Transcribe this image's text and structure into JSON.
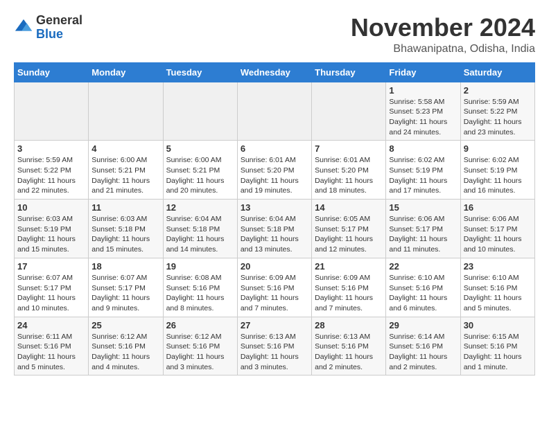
{
  "logo": {
    "general": "General",
    "blue": "Blue"
  },
  "title": "November 2024",
  "location": "Bhawanipatna, Odisha, India",
  "days_of_week": [
    "Sunday",
    "Monday",
    "Tuesday",
    "Wednesday",
    "Thursday",
    "Friday",
    "Saturday"
  ],
  "weeks": [
    [
      {
        "day": "",
        "sunrise": "",
        "sunset": "",
        "daylight": "",
        "empty": true
      },
      {
        "day": "",
        "sunrise": "",
        "sunset": "",
        "daylight": "",
        "empty": true
      },
      {
        "day": "",
        "sunrise": "",
        "sunset": "",
        "daylight": "",
        "empty": true
      },
      {
        "day": "",
        "sunrise": "",
        "sunset": "",
        "daylight": "",
        "empty": true
      },
      {
        "day": "",
        "sunrise": "",
        "sunset": "",
        "daylight": "",
        "empty": true
      },
      {
        "day": "1",
        "sunrise": "Sunrise: 5:58 AM",
        "sunset": "Sunset: 5:23 PM",
        "daylight": "Daylight: 11 hours and 24 minutes.",
        "empty": false
      },
      {
        "day": "2",
        "sunrise": "Sunrise: 5:59 AM",
        "sunset": "Sunset: 5:22 PM",
        "daylight": "Daylight: 11 hours and 23 minutes.",
        "empty": false
      }
    ],
    [
      {
        "day": "3",
        "sunrise": "Sunrise: 5:59 AM",
        "sunset": "Sunset: 5:22 PM",
        "daylight": "Daylight: 11 hours and 22 minutes.",
        "empty": false
      },
      {
        "day": "4",
        "sunrise": "Sunrise: 6:00 AM",
        "sunset": "Sunset: 5:21 PM",
        "daylight": "Daylight: 11 hours and 21 minutes.",
        "empty": false
      },
      {
        "day": "5",
        "sunrise": "Sunrise: 6:00 AM",
        "sunset": "Sunset: 5:21 PM",
        "daylight": "Daylight: 11 hours and 20 minutes.",
        "empty": false
      },
      {
        "day": "6",
        "sunrise": "Sunrise: 6:01 AM",
        "sunset": "Sunset: 5:20 PM",
        "daylight": "Daylight: 11 hours and 19 minutes.",
        "empty": false
      },
      {
        "day": "7",
        "sunrise": "Sunrise: 6:01 AM",
        "sunset": "Sunset: 5:20 PM",
        "daylight": "Daylight: 11 hours and 18 minutes.",
        "empty": false
      },
      {
        "day": "8",
        "sunrise": "Sunrise: 6:02 AM",
        "sunset": "Sunset: 5:19 PM",
        "daylight": "Daylight: 11 hours and 17 minutes.",
        "empty": false
      },
      {
        "day": "9",
        "sunrise": "Sunrise: 6:02 AM",
        "sunset": "Sunset: 5:19 PM",
        "daylight": "Daylight: 11 hours and 16 minutes.",
        "empty": false
      }
    ],
    [
      {
        "day": "10",
        "sunrise": "Sunrise: 6:03 AM",
        "sunset": "Sunset: 5:19 PM",
        "daylight": "Daylight: 11 hours and 15 minutes.",
        "empty": false
      },
      {
        "day": "11",
        "sunrise": "Sunrise: 6:03 AM",
        "sunset": "Sunset: 5:18 PM",
        "daylight": "Daylight: 11 hours and 15 minutes.",
        "empty": false
      },
      {
        "day": "12",
        "sunrise": "Sunrise: 6:04 AM",
        "sunset": "Sunset: 5:18 PM",
        "daylight": "Daylight: 11 hours and 14 minutes.",
        "empty": false
      },
      {
        "day": "13",
        "sunrise": "Sunrise: 6:04 AM",
        "sunset": "Sunset: 5:18 PM",
        "daylight": "Daylight: 11 hours and 13 minutes.",
        "empty": false
      },
      {
        "day": "14",
        "sunrise": "Sunrise: 6:05 AM",
        "sunset": "Sunset: 5:17 PM",
        "daylight": "Daylight: 11 hours and 12 minutes.",
        "empty": false
      },
      {
        "day": "15",
        "sunrise": "Sunrise: 6:06 AM",
        "sunset": "Sunset: 5:17 PM",
        "daylight": "Daylight: 11 hours and 11 minutes.",
        "empty": false
      },
      {
        "day": "16",
        "sunrise": "Sunrise: 6:06 AM",
        "sunset": "Sunset: 5:17 PM",
        "daylight": "Daylight: 11 hours and 10 minutes.",
        "empty": false
      }
    ],
    [
      {
        "day": "17",
        "sunrise": "Sunrise: 6:07 AM",
        "sunset": "Sunset: 5:17 PM",
        "daylight": "Daylight: 11 hours and 10 minutes.",
        "empty": false
      },
      {
        "day": "18",
        "sunrise": "Sunrise: 6:07 AM",
        "sunset": "Sunset: 5:17 PM",
        "daylight": "Daylight: 11 hours and 9 minutes.",
        "empty": false
      },
      {
        "day": "19",
        "sunrise": "Sunrise: 6:08 AM",
        "sunset": "Sunset: 5:16 PM",
        "daylight": "Daylight: 11 hours and 8 minutes.",
        "empty": false
      },
      {
        "day": "20",
        "sunrise": "Sunrise: 6:09 AM",
        "sunset": "Sunset: 5:16 PM",
        "daylight": "Daylight: 11 hours and 7 minutes.",
        "empty": false
      },
      {
        "day": "21",
        "sunrise": "Sunrise: 6:09 AM",
        "sunset": "Sunset: 5:16 PM",
        "daylight": "Daylight: 11 hours and 7 minutes.",
        "empty": false
      },
      {
        "day": "22",
        "sunrise": "Sunrise: 6:10 AM",
        "sunset": "Sunset: 5:16 PM",
        "daylight": "Daylight: 11 hours and 6 minutes.",
        "empty": false
      },
      {
        "day": "23",
        "sunrise": "Sunrise: 6:10 AM",
        "sunset": "Sunset: 5:16 PM",
        "daylight": "Daylight: 11 hours and 5 minutes.",
        "empty": false
      }
    ],
    [
      {
        "day": "24",
        "sunrise": "Sunrise: 6:11 AM",
        "sunset": "Sunset: 5:16 PM",
        "daylight": "Daylight: 11 hours and 5 minutes.",
        "empty": false
      },
      {
        "day": "25",
        "sunrise": "Sunrise: 6:12 AM",
        "sunset": "Sunset: 5:16 PM",
        "daylight": "Daylight: 11 hours and 4 minutes.",
        "empty": false
      },
      {
        "day": "26",
        "sunrise": "Sunrise: 6:12 AM",
        "sunset": "Sunset: 5:16 PM",
        "daylight": "Daylight: 11 hours and 3 minutes.",
        "empty": false
      },
      {
        "day": "27",
        "sunrise": "Sunrise: 6:13 AM",
        "sunset": "Sunset: 5:16 PM",
        "daylight": "Daylight: 11 hours and 3 minutes.",
        "empty": false
      },
      {
        "day": "28",
        "sunrise": "Sunrise: 6:13 AM",
        "sunset": "Sunset: 5:16 PM",
        "daylight": "Daylight: 11 hours and 2 minutes.",
        "empty": false
      },
      {
        "day": "29",
        "sunrise": "Sunrise: 6:14 AM",
        "sunset": "Sunset: 5:16 PM",
        "daylight": "Daylight: 11 hours and 2 minutes.",
        "empty": false
      },
      {
        "day": "30",
        "sunrise": "Sunrise: 6:15 AM",
        "sunset": "Sunset: 5:16 PM",
        "daylight": "Daylight: 11 hours and 1 minute.",
        "empty": false
      }
    ]
  ]
}
